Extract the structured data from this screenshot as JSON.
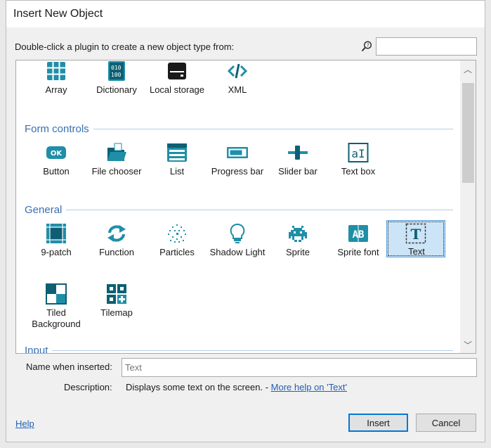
{
  "window": {
    "title": "Insert New Object"
  },
  "prompt": "Double-click a plugin to create a new object type from:",
  "search": {
    "value": "",
    "placeholder": ""
  },
  "sections": {
    "data_storage": {
      "items": [
        {
          "label": "Array",
          "icon": "array-icon"
        },
        {
          "label": "Dictionary",
          "icon": "dictionary-icon"
        },
        {
          "label": "Local storage",
          "icon": "local-storage-icon"
        },
        {
          "label": "XML",
          "icon": "xml-icon"
        }
      ]
    },
    "form_controls": {
      "title": "Form controls",
      "items": [
        {
          "label": "Button",
          "icon": "button-icon"
        },
        {
          "label": "File chooser",
          "icon": "file-chooser-icon"
        },
        {
          "label": "List",
          "icon": "list-icon"
        },
        {
          "label": "Progress bar",
          "icon": "progress-bar-icon"
        },
        {
          "label": "Slider bar",
          "icon": "slider-bar-icon"
        },
        {
          "label": "Text box",
          "icon": "text-box-icon"
        }
      ]
    },
    "general": {
      "title": "General",
      "items": [
        {
          "label": "9-patch",
          "icon": "nine-patch-icon"
        },
        {
          "label": "Function",
          "icon": "function-icon"
        },
        {
          "label": "Particles",
          "icon": "particles-icon"
        },
        {
          "label": "Shadow Light",
          "icon": "shadow-light-icon"
        },
        {
          "label": "Sprite",
          "icon": "sprite-icon"
        },
        {
          "label": "Sprite font",
          "icon": "sprite-font-icon"
        },
        {
          "label": "Text",
          "icon": "text-icon",
          "selected": true
        },
        {
          "label": "Tiled Background",
          "icon": "tiled-background-icon"
        },
        {
          "label": "Tilemap",
          "icon": "tilemap-icon"
        }
      ]
    },
    "input": {
      "title": "Input"
    }
  },
  "button_ok_glyph": "OK",
  "text_box_glyph": "aI",
  "sprite_font_glyph": "AB",
  "text_glyph": "T",
  "name_field": {
    "label": "Name when inserted:",
    "value": "Text"
  },
  "description": {
    "label": "Description:",
    "text": "Displays some text on the screen. - ",
    "link": "More help on 'Text'"
  },
  "footer": {
    "help": "Help",
    "insert": "Insert",
    "cancel": "Cancel"
  },
  "colors": {
    "icon_teal": "#1f8fa8",
    "icon_dark": "#0e5f73",
    "section_blue": "#3a6fb0",
    "selection_bg": "#cce4f7"
  }
}
